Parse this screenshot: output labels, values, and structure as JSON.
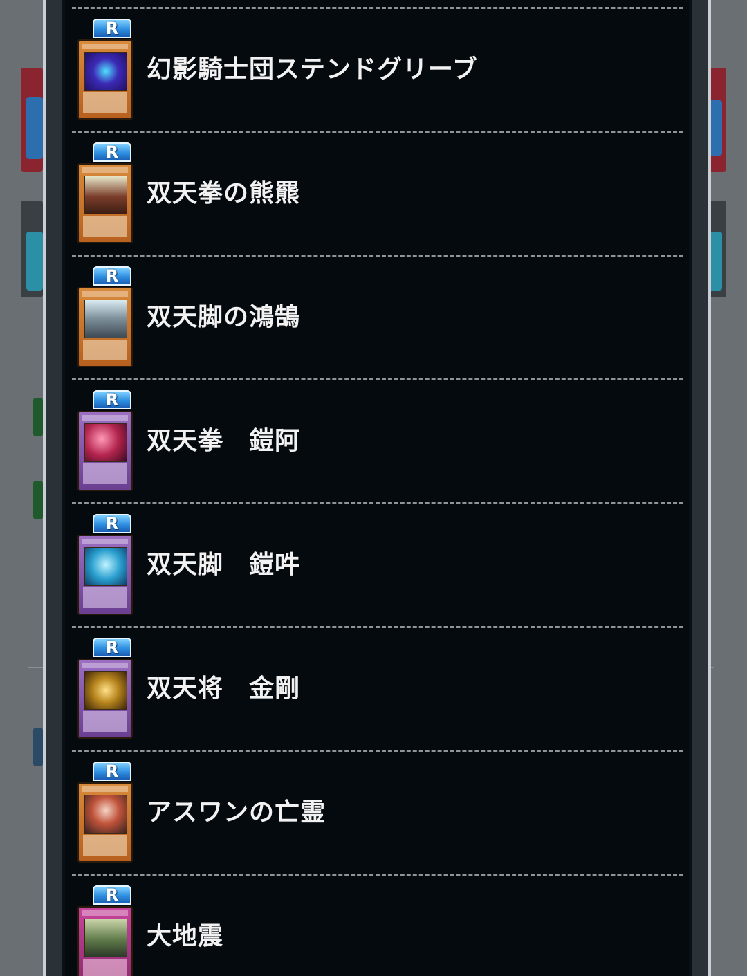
{
  "cards": [
    {
      "name": "幻影騎士団ステンドグリーブ",
      "rarity": "R",
      "frame": "effect",
      "art": "a1"
    },
    {
      "name": "双天拳の熊羆",
      "rarity": "R",
      "frame": "effect",
      "art": "a2"
    },
    {
      "name": "双天脚の鴻鵠",
      "rarity": "R",
      "frame": "effect",
      "art": "a3"
    },
    {
      "name": "双天拳　鎧阿",
      "rarity": "R",
      "frame": "xyz",
      "art": "a4"
    },
    {
      "name": "双天脚　鎧吽",
      "rarity": "R",
      "frame": "xyz",
      "art": "a5"
    },
    {
      "name": "双天将　金剛",
      "rarity": "R",
      "frame": "xyz",
      "art": "a6"
    },
    {
      "name": "アスワンの亡霊",
      "rarity": "R",
      "frame": "effect",
      "art": "a7"
    },
    {
      "name": "大地震",
      "rarity": "R",
      "frame": "trap",
      "art": "a8"
    }
  ],
  "colors": {
    "panel_bg": "#050a0e",
    "border": "#c9cfd4",
    "separator": "#8e959a",
    "rarity_blue": "#2f8fe0",
    "name_text": "#f2f2f2"
  }
}
